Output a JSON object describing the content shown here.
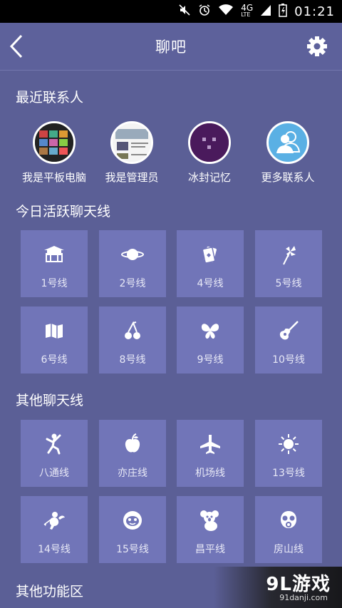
{
  "status_bar": {
    "network": "4G",
    "network_sub": "LTE",
    "time": "01:21",
    "icons": [
      "mute-icon",
      "alarm-icon",
      "wifi-icon",
      "signal-icon",
      "battery-icon"
    ]
  },
  "header": {
    "title": "聊吧"
  },
  "recent_contacts": {
    "title": "最近联系人",
    "items": [
      {
        "label": "我是平板电脑",
        "avatar": "tablet-photo"
      },
      {
        "label": "我是管理员",
        "avatar": "admin-photo"
      },
      {
        "label": "冰封记忆",
        "avatar": "pixel-face"
      },
      {
        "label": "更多联系人",
        "avatar": "contacts-icon"
      }
    ]
  },
  "today_lines": {
    "title": "今日活跃聊天线",
    "items": [
      {
        "label": "1号线",
        "icon": "palace-icon"
      },
      {
        "label": "2号线",
        "icon": "planet-icon"
      },
      {
        "label": "4号线",
        "icon": "cards-icon"
      },
      {
        "label": "5号线",
        "icon": "pinwheel-icon"
      },
      {
        "label": "6号线",
        "icon": "map-icon"
      },
      {
        "label": "8号线",
        "icon": "cherry-icon"
      },
      {
        "label": "9号线",
        "icon": "butterfly-icon"
      },
      {
        "label": "10号线",
        "icon": "guitar-icon"
      }
    ]
  },
  "other_lines": {
    "title": "其他聊天线",
    "items": [
      {
        "label": "八通线",
        "icon": "dancer-icon"
      },
      {
        "label": "亦庄线",
        "icon": "apple-icon"
      },
      {
        "label": "机场线",
        "icon": "airplane-icon"
      },
      {
        "label": "13号线",
        "icon": "sun-icon"
      },
      {
        "label": "14号线",
        "icon": "cupid-icon"
      },
      {
        "label": "15号线",
        "icon": "monkey-icon"
      },
      {
        "label": "昌平线",
        "icon": "koala-icon"
      },
      {
        "label": "房山线",
        "icon": "gasmask-icon"
      }
    ]
  },
  "other_functions": {
    "title": "其他功能区"
  },
  "watermark": {
    "main": "9L游戏",
    "sub": "91danji.com"
  },
  "colors": {
    "background": "#5b5f96",
    "tile": "#7175b8",
    "status_bar": "#000000",
    "text": "#ffffff",
    "contacts_avatar_bg": "#5ab0e4",
    "pixel_avatar_bg": "#4a1a5c"
  }
}
